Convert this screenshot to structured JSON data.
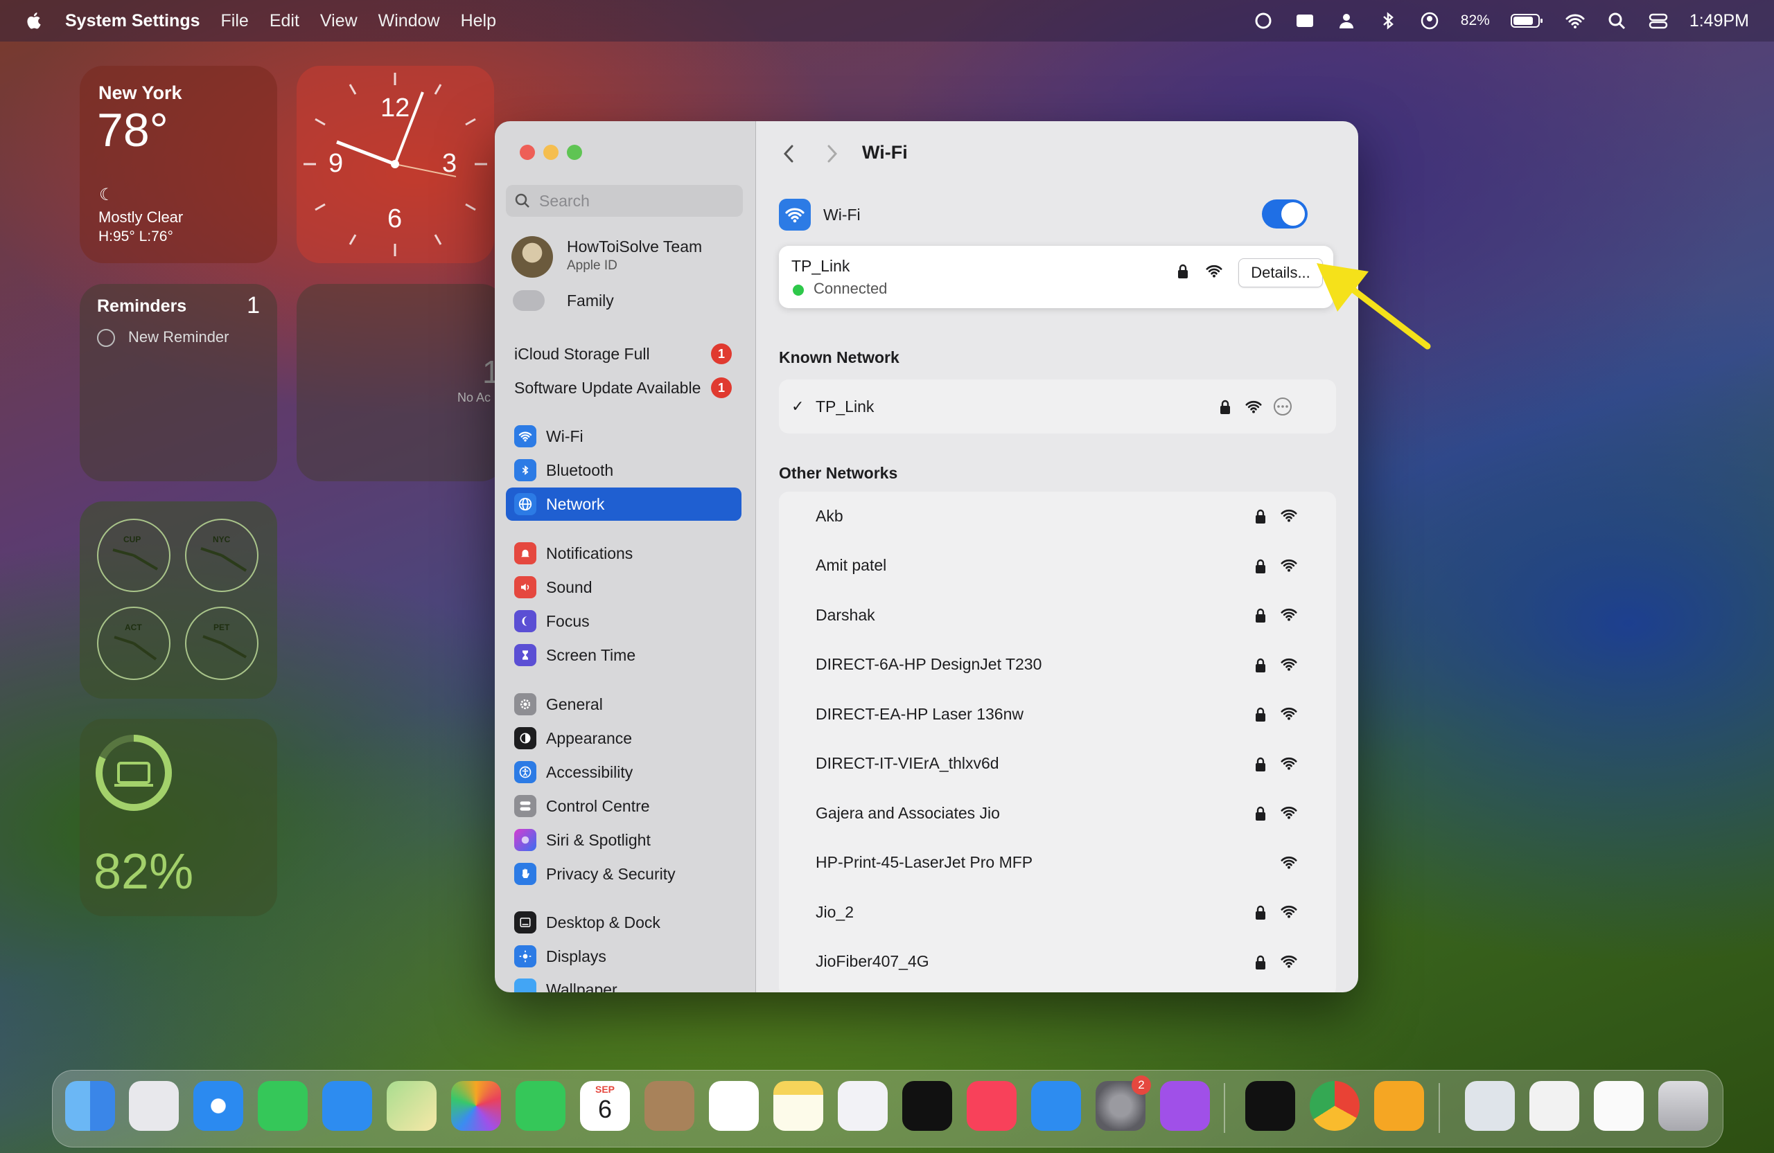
{
  "menubar": {
    "app_name": "System Settings",
    "menus": [
      "File",
      "Edit",
      "View",
      "Window",
      "Help"
    ],
    "battery": "82%",
    "time": "1:49PM"
  },
  "widgets": {
    "weather": {
      "city": "New York",
      "temp": "78°",
      "condition": "Mostly Clear",
      "range": "H:95° L:76°"
    },
    "clock_numbers": [
      "12",
      "3",
      "6",
      "9"
    ],
    "reminders": {
      "title": "Reminders",
      "count": "1",
      "item": "New Reminder"
    },
    "partial": {
      "digit": "1",
      "label": "No Ac"
    },
    "world_clocks": [
      "CUP",
      "NYC",
      "ACT",
      "PET"
    ],
    "battery": {
      "percent": "82%"
    }
  },
  "window": {
    "title": "Wi-Fi",
    "search_placeholder": "Search",
    "account": {
      "name": "HowToiSolve Team",
      "sub": "Apple ID"
    },
    "family": "Family",
    "alerts": [
      {
        "label": "iCloud Storage Full",
        "badge": "1"
      },
      {
        "label": "Software Update Available",
        "badge": "1"
      }
    ],
    "sidebar_group1": [
      "Wi-Fi",
      "Bluetooth",
      "Network"
    ],
    "sidebar_group2": [
      "Notifications",
      "Sound",
      "Focus",
      "Screen Time"
    ],
    "sidebar_group3": [
      "General",
      "Appearance",
      "Accessibility",
      "Control Centre",
      "Siri & Spotlight",
      "Privacy & Security"
    ],
    "sidebar_group4": [
      "Desktop & Dock",
      "Displays",
      "Wallpaper"
    ],
    "selected_item": "Network",
    "wifi_label": "Wi-Fi",
    "wifi_enabled": true,
    "connected": {
      "name": "TP_Link",
      "status": "Connected",
      "details_button": "Details..."
    },
    "known_header": "Known Network",
    "known": [
      {
        "name": "TP_Link",
        "checked": "✓"
      }
    ],
    "other_header": "Other Networks",
    "other": [
      {
        "name": "Akb",
        "locked": true
      },
      {
        "name": "Amit patel",
        "locked": true
      },
      {
        "name": "Darshak",
        "locked": true
      },
      {
        "name": "DIRECT-6A-HP DesignJet T230",
        "locked": true
      },
      {
        "name": "DIRECT-EA-HP Laser 136nw",
        "locked": true
      },
      {
        "name": "DIRECT-IT-VIErA_thlxv6d",
        "locked": true
      },
      {
        "name": "Gajera and Associates Jio",
        "locked": true
      },
      {
        "name": "HP-Print-45-LaserJet Pro MFP",
        "locked": false
      },
      {
        "name": "Jio_2",
        "locked": true
      },
      {
        "name": "JioFiber407_4G",
        "locked": true
      }
    ]
  },
  "dock": {
    "calendar": {
      "month": "SEP",
      "day": "6"
    },
    "settings_badge": "2"
  },
  "colors": {
    "accent": "#1f5fd1",
    "annotation_arrow": "#f5e11a",
    "connected_dot": "#2ec84a"
  }
}
